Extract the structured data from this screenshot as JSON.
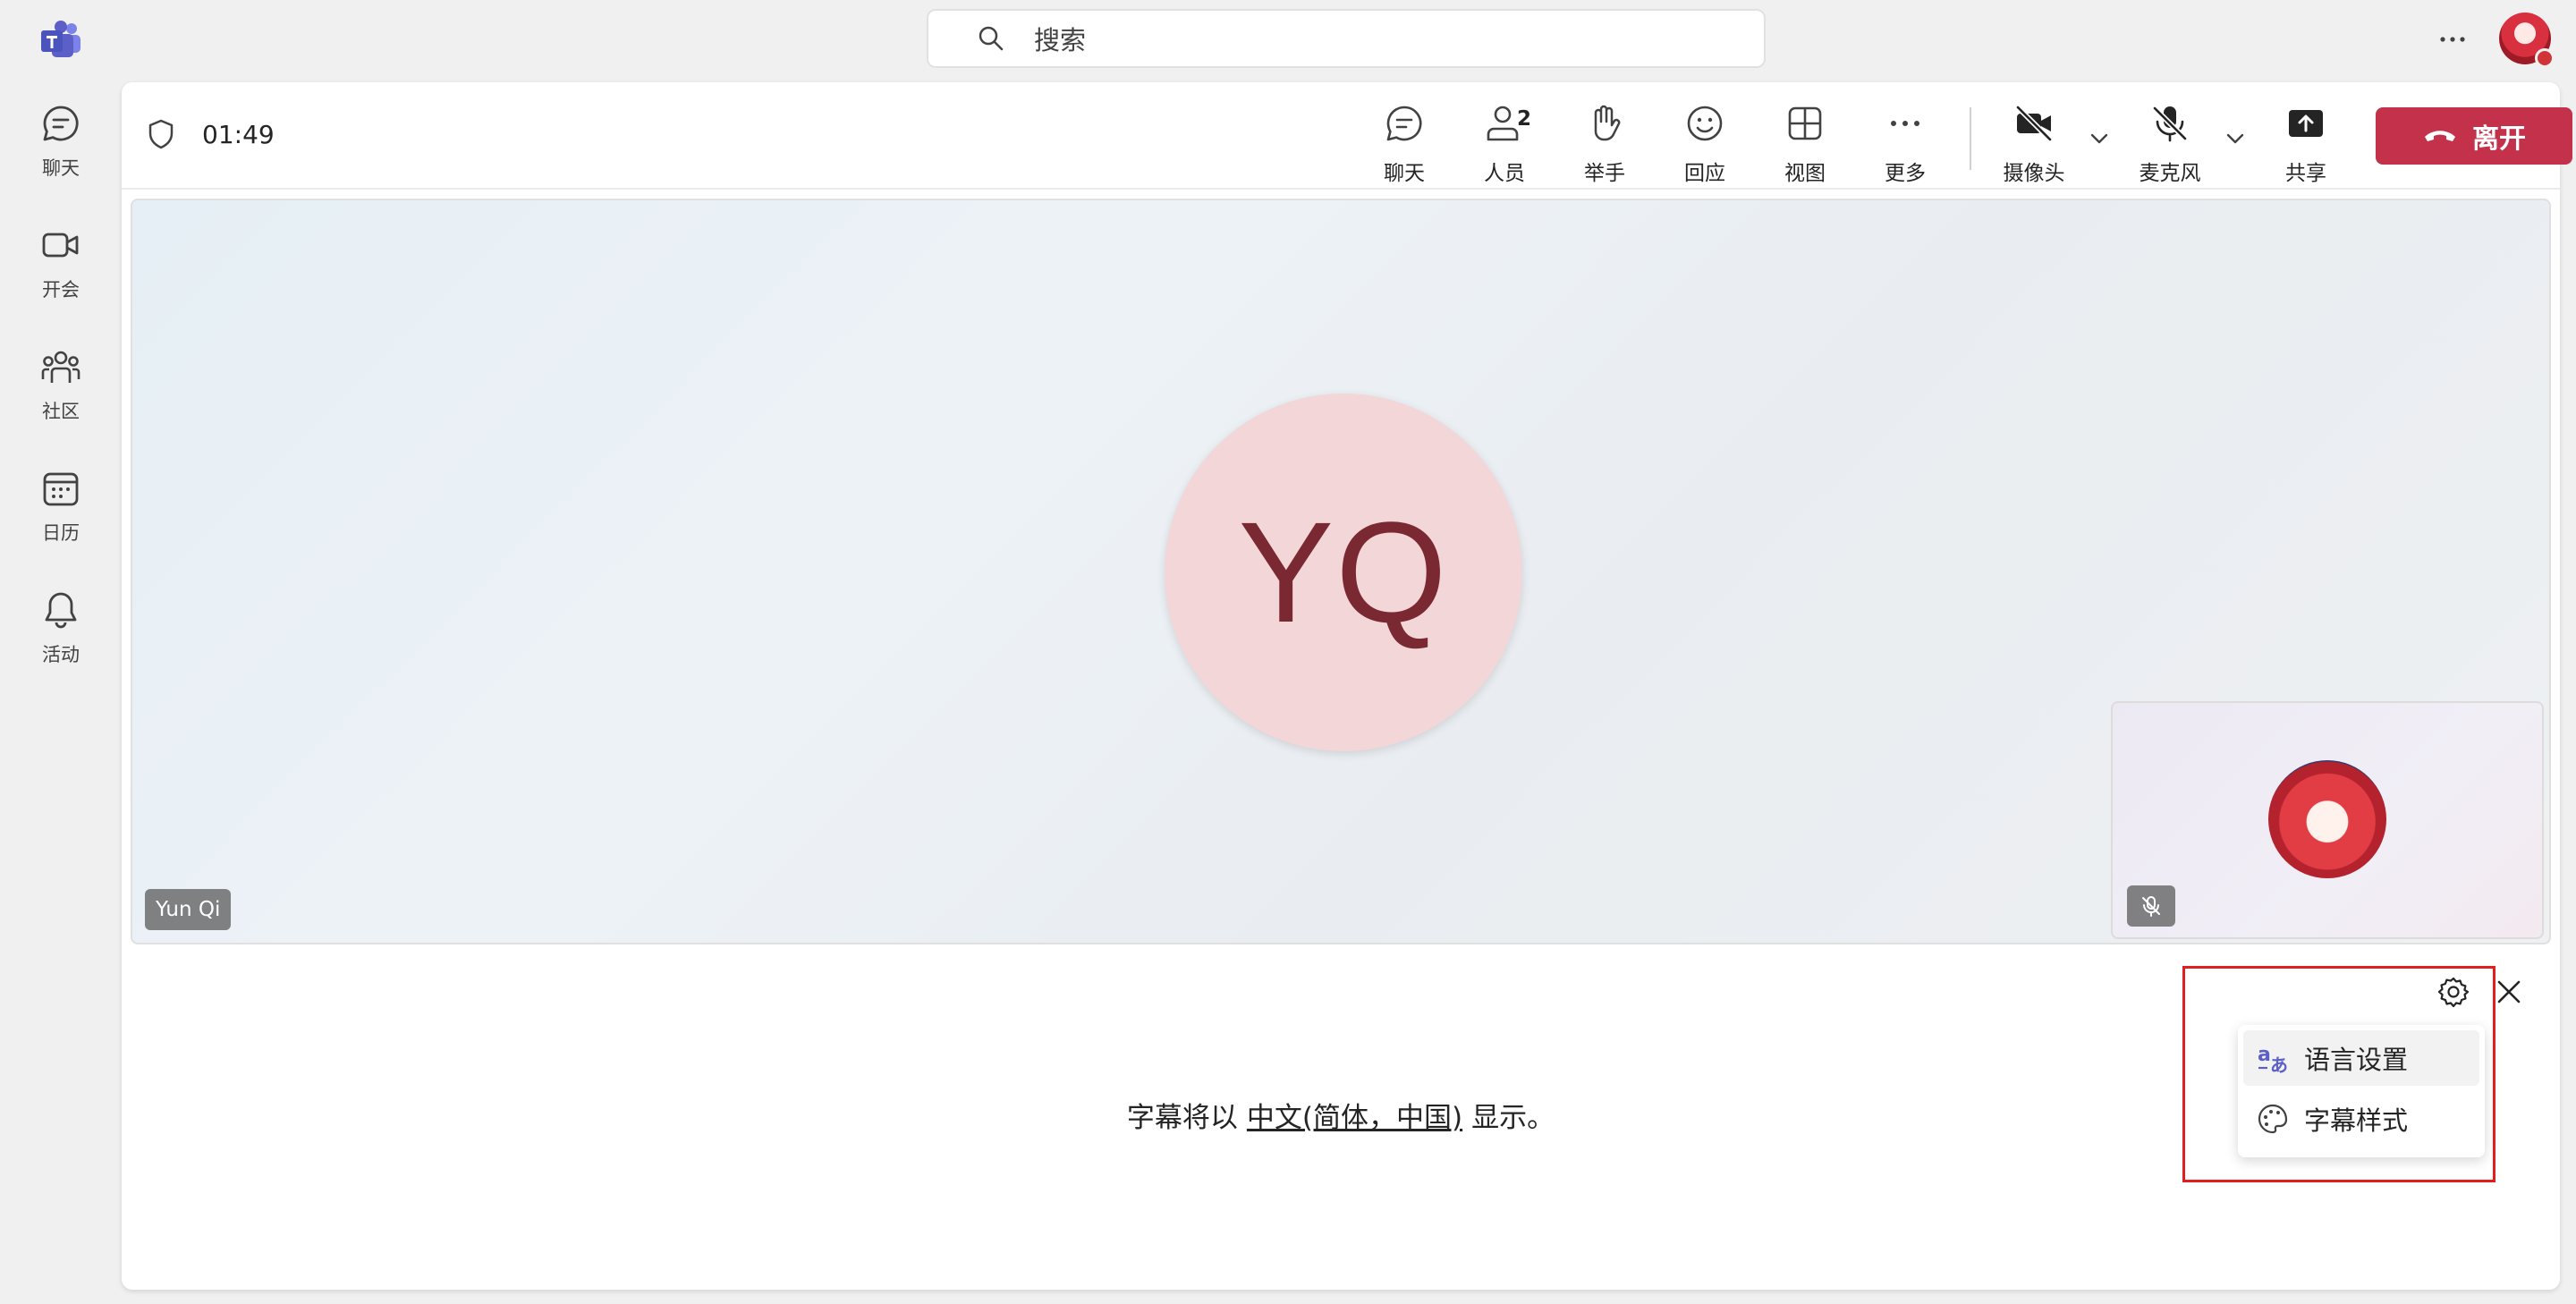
{
  "topbar": {
    "search_placeholder": "搜索"
  },
  "rail": {
    "items": [
      {
        "label": "聊天",
        "icon": "chat-icon"
      },
      {
        "label": "开会",
        "icon": "video-icon"
      },
      {
        "label": "社区",
        "icon": "community-icon"
      },
      {
        "label": "日历",
        "icon": "calendar-icon"
      },
      {
        "label": "活动",
        "icon": "bell-icon"
      }
    ]
  },
  "meeting": {
    "timer": "01:49",
    "toolbar": {
      "chat": "聊天",
      "people": "人员",
      "people_count": "2",
      "raise_hand": "举手",
      "react": "回应",
      "view": "视图",
      "more": "更多",
      "camera": "摄像头",
      "mic": "麦克风",
      "share": "共享",
      "leave": "离开"
    },
    "participant": {
      "initials": "YQ",
      "name": "Yun Qi"
    }
  },
  "captions": {
    "prefix": "字幕将以",
    "language": "中文(简体，中国)",
    "suffix": "显示。",
    "menu": [
      {
        "label": "语言设置",
        "icon": "language-icon"
      },
      {
        "label": "字幕样式",
        "icon": "palette-icon"
      }
    ]
  },
  "colors": {
    "leave": "#c4314b",
    "teams_purple": "#5b5fc7",
    "highlight_box": "#e02020"
  }
}
